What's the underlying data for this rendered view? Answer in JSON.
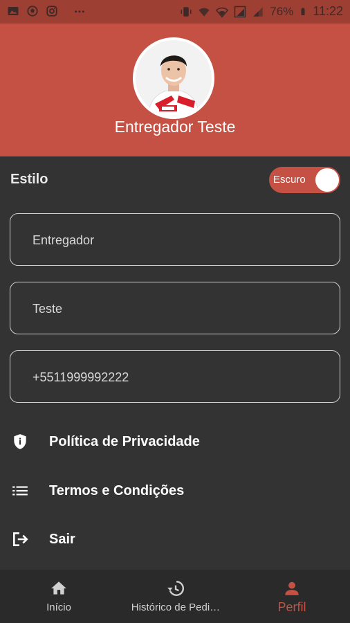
{
  "status_bar": {
    "battery": "76%",
    "time": "11:22",
    "left_icons": [
      "image-icon",
      "soccer-ball-icon",
      "instagram-icon",
      "more-dots-icon"
    ],
    "right_icons": [
      "vibrate-icon",
      "vowifi-icon",
      "wifi-icon",
      "signal-1-icon",
      "signal-icon",
      "battery-icon"
    ]
  },
  "profile": {
    "name": "Entregador Teste"
  },
  "style_setting": {
    "label": "Estilo",
    "toggle_label": "Escuro",
    "enabled": true
  },
  "fields": [
    {
      "value": "Entregador"
    },
    {
      "value": "Teste"
    },
    {
      "value": "+5511999992222"
    }
  ],
  "menu": [
    {
      "label": "Política de Privacidade",
      "icon": "shield-icon"
    },
    {
      "label": "Termos e Condições",
      "icon": "list-icon"
    },
    {
      "label": "Sair",
      "icon": "logout-icon"
    }
  ],
  "bottom_nav": [
    {
      "label": "Início",
      "icon": "home-icon",
      "active": false
    },
    {
      "label": "Histórico de Pedi…",
      "icon": "history-icon",
      "active": false
    },
    {
      "label": "Perfil",
      "icon": "person-icon",
      "active": true
    }
  ],
  "colors": {
    "accent": "#c45144",
    "status_bar": "#9e3f33",
    "background": "#333333",
    "nav_background": "#2a2a2a",
    "nav_inactive": "#d0d0d0"
  }
}
